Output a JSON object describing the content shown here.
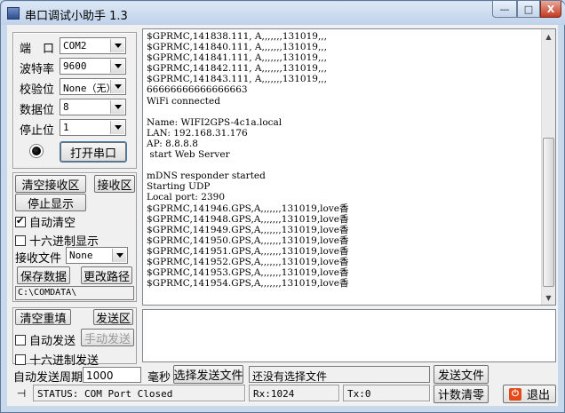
{
  "window": {
    "title": "串口调试小助手 1.3",
    "controls": {
      "minimize": "—",
      "maximize": "□",
      "close": "X"
    }
  },
  "serial": {
    "port_label": "端　口",
    "port_value": "COM2",
    "baud_label": "波特率",
    "baud_value": "9600",
    "parity_label": "校验位",
    "parity_value": "None（无）",
    "databits_label": "数据位",
    "databits_value": "8",
    "stopbits_label": "停止位",
    "stopbits_value": "1",
    "open_button": "打开串口"
  },
  "receive_panel": {
    "clear_button": "清空接收区",
    "receive_area_button": "接收区",
    "stop_display_button": "停止显示",
    "auto_clear_label": "自动清空",
    "auto_clear_checked": true,
    "hex_display_label": "十六进制显示",
    "hex_display_checked": false,
    "recv_file_label": "接收文件",
    "recv_file_value": "None",
    "save_data_button": "保存数据",
    "change_path_button": "更改路径",
    "path_value": "C:\\COMDATA\\"
  },
  "receive_lines": [
    "$GPRMC,141838.111, A,,,,,,,131019,,,",
    "$GPRMC,141840.111, A,,,,,,,131019,,,",
    "$GPRMC,141841.111, A,,,,,,,131019,,,",
    "$GPRMC,141842.111, A,,,,,,,131019,,,",
    "$GPRMC,141843.111, A,,,,,,,131019,,,",
    "66666666666666663",
    "WiFi connected",
    "",
    "Name: WIFI2GPS-4c1a.local",
    "LAN: 192.168.31.176",
    "AP: 8.8.8.8",
    " start Web Server",
    "",
    "mDNS responder started",
    "Starting UDP",
    "Local port: 2390",
    "$GPRMC,141946.GPS,A,,,,,,,131019,love香",
    "$GPRMC,141948.GPS,A,,,,,,,131019,love香",
    "$GPRMC,141949.GPS,A,,,,,,,131019,love香",
    "$GPRMC,141950.GPS,A,,,,,,,131019,love香",
    "$GPRMC,141951.GPS,A,,,,,,,131019,love香",
    "$GPRMC,141952.GPS,A,,,,,,,131019,love香",
    "$GPRMC,141953.GPS,A,,,,,,,131019,love香",
    "$GPRMC,141954.GPS,A,,,,,,,131019,love香"
  ],
  "send_panel": {
    "clear_resend_button": "清空重填",
    "send_area_button": "发送区",
    "auto_send_label": "自动发送",
    "auto_send_checked": false,
    "manual_send_button": "手动发送",
    "hex_send_label": "十六进制发送",
    "hex_send_checked": false,
    "period_label": "自动发送周期",
    "period_value": "1000",
    "ms_label": "毫秒",
    "select_file_button": "选择发送文件",
    "file_status": "还没有选择文件",
    "send_file_button": "发送文件"
  },
  "status": {
    "text": "STATUS: COM Port Closed",
    "rx": "Rx:1024",
    "tx": "Tx:0",
    "reset_count_button": "计数清零",
    "exit_button": "退出"
  }
}
